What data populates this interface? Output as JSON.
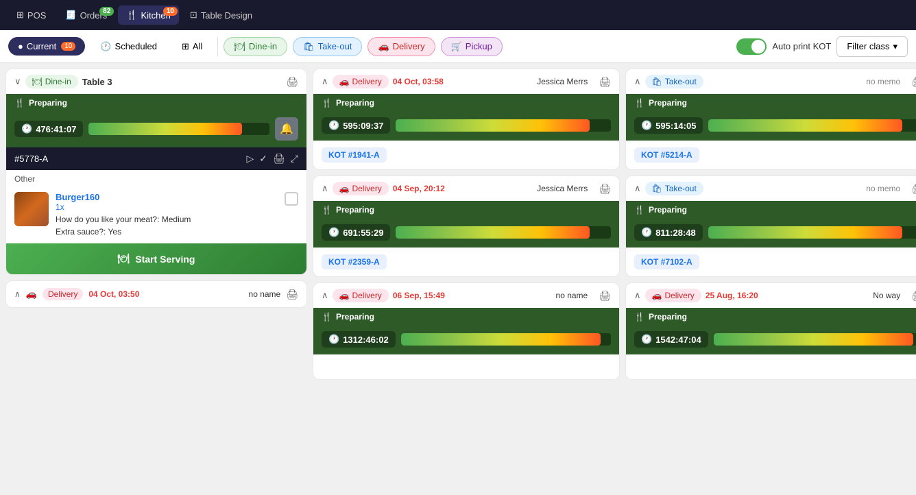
{
  "nav": {
    "pos_label": "POS",
    "orders_label": "Orders",
    "orders_badge": "82",
    "kitchen_label": "Kitchen",
    "kitchen_badge": "10",
    "table_design_label": "Table Design"
  },
  "filter_bar": {
    "current_label": "Current",
    "current_badge": "10",
    "scheduled_label": "Scheduled",
    "all_label": "All",
    "dine_in_label": "Dine-in",
    "take_out_label": "Take-out",
    "delivery_label": "Delivery",
    "pickup_label": "Pickup",
    "auto_print_label": "Auto print KOT",
    "filter_class_label": "Filter class"
  },
  "left_col": {
    "card1": {
      "tag": "Dine-in",
      "table": "Table 3",
      "section": "Preparing",
      "timer": "476:41:07",
      "progress": 85,
      "order_id": "#5778-A",
      "order_type": "Other",
      "item_name": "Burger160",
      "item_qty": "1x",
      "item_note": "How do you like your meat?: Medium\nExtra sauce?: Yes",
      "start_serving": "Start Serving"
    },
    "card2": {
      "tag": "Delivery",
      "date": "04 Oct, 03:50",
      "name": "no name",
      "collapsed": true
    }
  },
  "mid_col": {
    "card1": {
      "tag": "Delivery",
      "date": "04 Oct, 03:58",
      "name": "Jessica Merrs",
      "section": "Preparing",
      "timer": "595:09:37",
      "progress": 90,
      "kot": "KOT #1941-A"
    },
    "card2": {
      "tag": "Delivery",
      "date": "04 Sep, 20:12",
      "name": "Jessica Merrs",
      "section": "Preparing",
      "timer": "691:55:29",
      "progress": 90,
      "kot": "KOT #2359-A"
    },
    "card3": {
      "tag": "Delivery",
      "date": "06 Sep, 15:49",
      "name": "no name",
      "section": "Preparing",
      "timer": "1312:46:02",
      "progress": 95,
      "kot": ""
    }
  },
  "right_col": {
    "card1": {
      "tag": "Take-out",
      "memo": "no memo",
      "section": "Preparing",
      "timer": "595:14:05",
      "progress": 90,
      "kot": "KOT #5214-A"
    },
    "card2": {
      "tag": "Take-out",
      "memo": "no memo",
      "section": "Preparing",
      "timer": "811:28:48",
      "progress": 90,
      "kot": "KOT #7102-A"
    },
    "card3": {
      "tag": "Delivery",
      "date": "25 Aug, 16:20",
      "name": "No way",
      "section": "Preparing",
      "timer": "1542:47:04",
      "progress": 95,
      "kot": ""
    }
  }
}
